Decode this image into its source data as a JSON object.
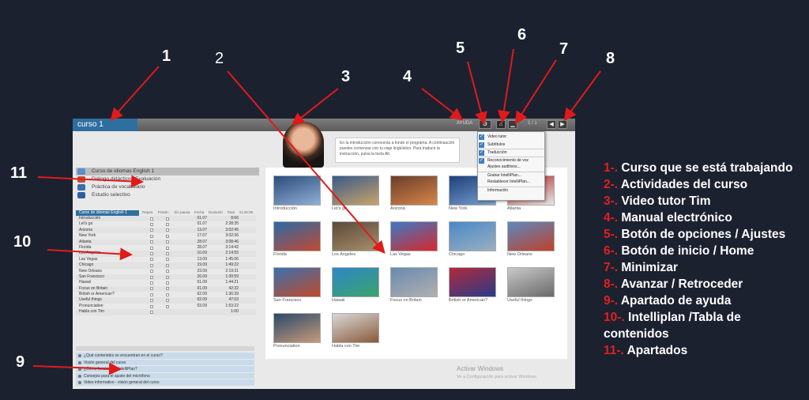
{
  "app": {
    "course_tab": "curso 1",
    "help_label": "AYUDA",
    "page_counter": "1 / 1",
    "gear_glyph": "⚙",
    "home_glyph": "⌂",
    "min_glyph": "▁",
    "prev_glyph": "◀",
    "next_glyph": "▶",
    "intro_text": "En la introducción conocerás a fondo el programa. A continuación puedes comenzar con tu viaje lingüístico. Para traducir la instrucción, pulsa la tecla Alt.",
    "options_menu": [
      {
        "label": "Video tutor",
        "checked": true
      },
      {
        "label": "Subtítulos",
        "checked": true
      },
      {
        "label": "Traducción",
        "checked": true
      },
      {
        "label": "Reconocimiento de voz",
        "checked": true
      },
      {
        "label": "Ajustes auditivos...",
        "checked": false
      },
      {
        "label": "Grabar IntelliPlan...",
        "checked": false
      },
      {
        "label": "Restablecer IntelliPlan...",
        "checked": false
      },
      {
        "label": "Información",
        "checked": false
      }
    ],
    "sections": [
      {
        "label": "Curso de idiomas English 1",
        "active": true,
        "color": "#5a8fc7"
      },
      {
        "label": "Diálogo didáctico · Evaluación",
        "active": false,
        "color": "#c0503a"
      },
      {
        "label": "Práctica de vocabulario",
        "active": false,
        "color": "#3a6fb0"
      },
      {
        "label": "Estudio selectivo",
        "active": false,
        "color": "#2e5f9f"
      }
    ],
    "toc_headers": [
      "Repas.",
      "Práctic.",
      "Sin pausa",
      "Fecha",
      "Duración",
      "Total"
    ],
    "toc_title": "Curso de idiomas English 1",
    "toc_total_header": "31:26:35",
    "toc_rows": [
      {
        "name": "Introducción",
        "date": "01.07",
        "time": "8:66"
      },
      {
        "name": "Let's go",
        "date": "01.07",
        "time": "2:28:35"
      },
      {
        "name": "Arizona",
        "date": "13.07",
        "time": "3:02:45"
      },
      {
        "name": "New York",
        "date": "17.07",
        "time": "3:02:36"
      },
      {
        "name": "Atlanta",
        "date": "28.07",
        "time": "3:08:46"
      },
      {
        "name": "Florida",
        "date": "28.07",
        "time": "3:14:42"
      },
      {
        "name": "Los Angeles",
        "date": "10.09",
        "time": "2:14:55"
      },
      {
        "name": "Las Vegas",
        "date": "13.09",
        "time": "1:45:06"
      },
      {
        "name": "Chicago",
        "date": "19.09",
        "time": "1:49:22"
      },
      {
        "name": "New Orleans",
        "date": "23.09",
        "time": "2:19:31"
      },
      {
        "name": "San Francisco",
        "date": "26.09",
        "time": "1:30:59"
      },
      {
        "name": "Hawaii",
        "date": "01.09",
        "time": "1:44:21"
      },
      {
        "name": "Focus on Britain",
        "date": "01.09",
        "time": "42:32"
      },
      {
        "name": "British or American?",
        "date": "02.09",
        "time": "1:36:39"
      },
      {
        "name": "Useful things",
        "date": "02.09",
        "time": "47:03"
      },
      {
        "name": "Pronunciation",
        "date": "03.09",
        "time": "1:53:22"
      },
      {
        "name": "Habla con Tim",
        "date": "",
        "time": "1:00"
      }
    ],
    "help_items": [
      "¿Qué contenidos se encuentran en el curso?",
      "Visión general del curso",
      "¿Cómo funciona el IntelliPlan?",
      "Consejos para el ajuste del micrófono",
      "Video informativo - visión general del curso"
    ],
    "thumbnails": [
      {
        "caption": "Introducción",
        "colors": [
          "#2d4c7a",
          "#8fb0d8"
        ]
      },
      {
        "caption": "Let's go",
        "colors": [
          "#3a5a8a",
          "#c9a46a"
        ]
      },
      {
        "caption": "Arizona",
        "colors": [
          "#6a3d2a",
          "#d8864a"
        ]
      },
      {
        "caption": "New York",
        "colors": [
          "#1c3f7a",
          "#7aa0d0"
        ]
      },
      {
        "caption": "Atlanta",
        "colors": [
          "#b02020",
          "#e6e6e6"
        ]
      },
      {
        "caption": "Florida",
        "colors": [
          "#2a6aa8",
          "#c24a30"
        ]
      },
      {
        "caption": "Los Angeles",
        "colors": [
          "#5a4a3a",
          "#a88e6a"
        ]
      },
      {
        "caption": "Las Vegas",
        "colors": [
          "#3a7ac8",
          "#d8282a"
        ]
      },
      {
        "caption": "Chicago",
        "colors": [
          "#4a88c8",
          "#9ab0c0"
        ]
      },
      {
        "caption": "New Orleans",
        "colors": [
          "#5a8ac0",
          "#c0402a"
        ]
      },
      {
        "caption": "San Francisco",
        "colors": [
          "#3a70b0",
          "#c04a2a"
        ]
      },
      {
        "caption": "Hawaii",
        "colors": [
          "#2f86c8",
          "#3aa46a"
        ]
      },
      {
        "caption": "Focus on Britain",
        "colors": [
          "#6a8ab0",
          "#b0b0b0"
        ]
      },
      {
        "caption": "British or American?",
        "colors": [
          "#b02a3a",
          "#2a3a8a"
        ]
      },
      {
        "caption": "Useful things",
        "colors": [
          "#c8c8c8",
          "#6a6a6a"
        ]
      },
      {
        "caption": "Pronunciation",
        "colors": [
          "#2a4a6a",
          "#c89a7a"
        ]
      },
      {
        "caption": "Habla con Tim",
        "colors": [
          "#d8d8d8",
          "#8a5a3a"
        ]
      }
    ],
    "activate_title": "Activar Windows",
    "activate_sub": "Ve a Configuración para activar Windows."
  },
  "callout_numbers": [
    "1",
    "2",
    "3",
    "4",
    "5",
    "6",
    "7",
    "8",
    "9",
    "10",
    "11"
  ],
  "legend": [
    {
      "key": "1-.",
      "text": " Curso que se está trabajando"
    },
    {
      "key": "2-.",
      "text": " Actividades del curso"
    },
    {
      "key": "3-.",
      "text": " Video tutor Tim"
    },
    {
      "key": "4-.",
      "text": " Manual electrónico"
    },
    {
      "key": "5-.",
      "text": " Botón de opciones / Ajustes"
    },
    {
      "key": "6-.",
      "text": " Botón de inicio / Home"
    },
    {
      "key": "7-.",
      "text": " Minimizar"
    },
    {
      "key": "8-.",
      "text": "  Avanzar / Retroceder"
    },
    {
      "key": "9-.",
      "text": "  Apartado de ayuda"
    },
    {
      "key": "10-.",
      "text": " Intelliplan /Tabla de contenidos"
    },
    {
      "key": "11-.",
      "text": " Apartados"
    }
  ],
  "arrow_color": "#e01a1a"
}
